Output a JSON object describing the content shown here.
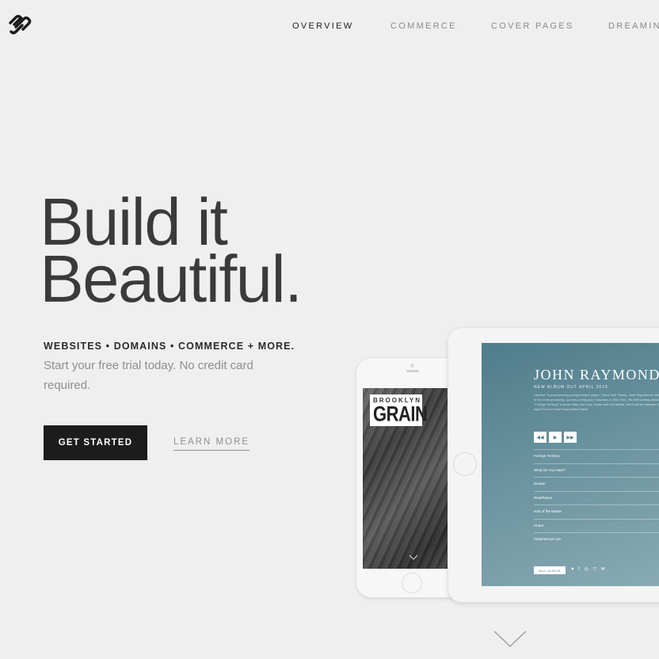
{
  "nav": {
    "items": [
      {
        "label": "OVERVIEW",
        "active": true
      },
      {
        "label": "COMMERCE",
        "active": false
      },
      {
        "label": "COVER PAGES",
        "active": false
      },
      {
        "label": "DREAMING",
        "active": false
      }
    ]
  },
  "hero": {
    "title_line1": "Build it",
    "title_line2": "Beautiful.",
    "tagline": "WEBSITES • DOMAINS • COMMERCE + MORE.",
    "subtext": "Start your free trial today. No credit card required.",
    "cta_primary": "GET STARTED",
    "cta_secondary": "LEARN MORE"
  },
  "phone": {
    "brand_small": "BROOKLYN",
    "brand_big": "GRAIN"
  },
  "tablet": {
    "album_title": "JOHN RAYMOND",
    "album_sub": "NEW ALBUM OUT APRIL 2015",
    "album_desc": "Labeled \"a preposessing young trumpet player,\" (New York Times), John Raymond is one of the most promising, up-and-coming jazz musicians in New York. His forthcoming album \"Foreign Territory\" includes Billy Hart, Dan Tepfer and Joe Martin, and it will be released in April 2015 on Fresh Sound/New Talent.",
    "controls": [
      "◀◀",
      "▶",
      "▶▶"
    ],
    "tracks": [
      "Foreign Territory",
      "What Do You Hear?",
      "Deeper",
      "Rest/Peace",
      "Hart of the Matter",
      "Chant",
      "Adventurous Lee"
    ],
    "buy_label": "BUY ALBUM",
    "socials": "♥ f ◎ ▽ ✉"
  },
  "colors": {
    "background": "#efefef",
    "primary_button": "#1c1c1c",
    "tablet_screen": "#5f8896"
  }
}
